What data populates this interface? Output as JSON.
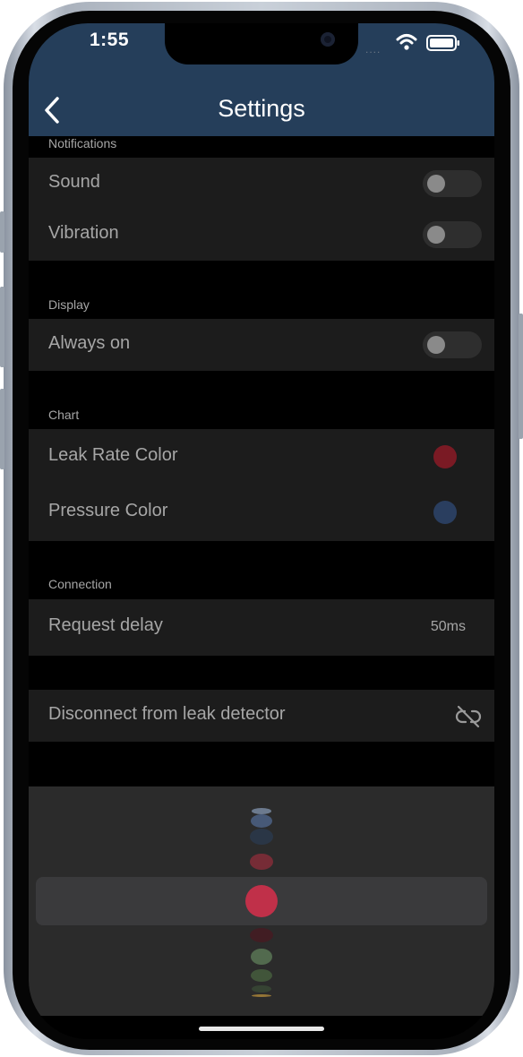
{
  "status_bar": {
    "time": "1:55",
    "signal": "....",
    "wifi_icon": "wifi-icon",
    "battery_icon": "battery-icon"
  },
  "header": {
    "title": "Settings",
    "back_icon": "chevron-left-icon",
    "background": "#253e5a"
  },
  "sections": {
    "notifications": {
      "label": "Notifications",
      "sound": {
        "label": "Sound",
        "on": false
      },
      "vibration": {
        "label": "Vibration",
        "on": false
      }
    },
    "display": {
      "label": "Display",
      "always_on": {
        "label": "Always on",
        "on": false
      }
    },
    "chart": {
      "label": "Chart",
      "leak_rate_color": {
        "label": "Leak Rate Color",
        "color": "#7a1a24"
      },
      "pressure_color": {
        "label": "Pressure Color",
        "color": "#2a3e5f"
      }
    },
    "connection": {
      "label": "Connection",
      "request_delay": {
        "label": "Request delay",
        "value": "50ms"
      }
    },
    "disconnect": {
      "label": "Disconnect from leak detector",
      "icon": "unlink-icon"
    }
  },
  "color_picker": {
    "selected_color": "#c03049",
    "swatch_colors": [
      "#7d8fa8",
      "#4c6285",
      "#2b3a4e",
      "#8a2d3a",
      "#c03049",
      "#4a1a22",
      "#5c7a58",
      "#47603f",
      "#3a4a36",
      "#b08a3a"
    ]
  }
}
